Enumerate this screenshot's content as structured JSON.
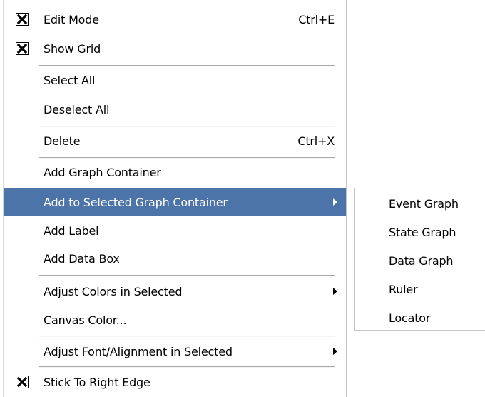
{
  "menu": {
    "edit_mode": {
      "label": "Edit Mode",
      "accel": "Ctrl+E",
      "checked": true
    },
    "show_grid": {
      "label": "Show Grid",
      "checked": true
    },
    "select_all": {
      "label": "Select All"
    },
    "deselect_all": {
      "label": "Deselect All"
    },
    "delete": {
      "label": "Delete",
      "accel": "Ctrl+X"
    },
    "add_graph_container": {
      "label": "Add Graph Container"
    },
    "add_to_selected": {
      "label": "Add to Selected Graph Container",
      "submenu": true
    },
    "add_label": {
      "label": "Add Label"
    },
    "add_data_box": {
      "label": "Add Data Box"
    },
    "adjust_colors": {
      "label": "Adjust Colors in Selected",
      "submenu": true
    },
    "canvas_color": {
      "label": "Canvas Color..."
    },
    "adjust_font": {
      "label": "Adjust Font/Alignment in Selected",
      "submenu": true
    },
    "stick_right": {
      "label": "Stick To Right Edge",
      "checked": true
    }
  },
  "submenu": {
    "items": [
      {
        "label": "Event Graph"
      },
      {
        "label": "State Graph"
      },
      {
        "label": "Data Graph"
      },
      {
        "label": "Ruler"
      },
      {
        "label": "Locator"
      }
    ]
  },
  "colors": {
    "highlight": "#4d74a8",
    "highlight_text": "#ffffff",
    "separator": "#a8a8a8"
  },
  "icons": {
    "checkbox": "checkbox-checked-icon",
    "submenu_arrow": "chevron-right-icon"
  }
}
